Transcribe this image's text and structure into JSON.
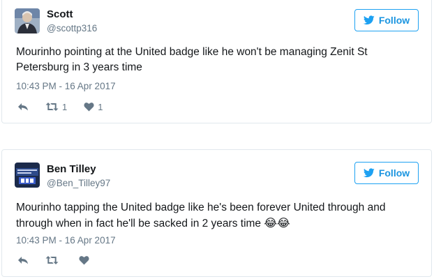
{
  "tweets": [
    {
      "name": "Scott",
      "handle": "@scottp316",
      "follow_label": "Follow",
      "text": "Mourinho pointing at the United badge like he won't be managing Zenit St Petersburg in 3 years time",
      "emoji": "",
      "timestamp": "10:43 PM - 16 Apr 2017",
      "retweets": "1",
      "likes": "1",
      "avatar_icon": "user-photo-avatar"
    },
    {
      "name": "Ben Tilley",
      "handle": "@Ben_Tilley97",
      "follow_label": "Follow",
      "text": "Mourinho tapping the United badge like he's been forever United through and through when in fact he'll be sacked in 2 years time",
      "emoji": "😂😂",
      "timestamp": "10:43 PM - 16 Apr 2017",
      "retweets": "",
      "likes": "",
      "avatar_icon": "mourinho-out-banner-avatar"
    }
  ],
  "colors": {
    "accent": "#1da1f2",
    "text": "#14171a",
    "muted": "#657786",
    "border": "#e1e8ed"
  },
  "icons": {
    "follow": "twitter-bird-icon",
    "reply": "reply-icon",
    "retweet": "retweet-icon",
    "like": "heart-icon"
  }
}
